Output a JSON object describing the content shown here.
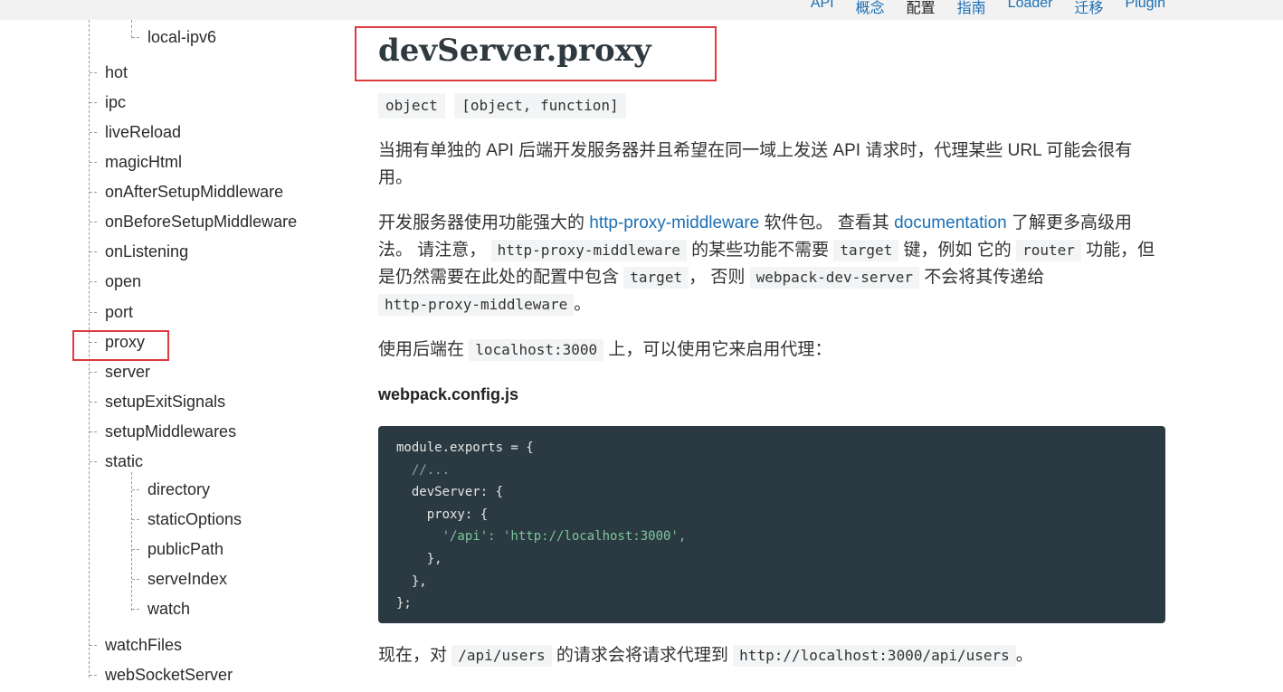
{
  "topnav": {
    "items": [
      "API",
      "概念",
      "配置",
      "指南",
      "Loader",
      "迁移",
      "Plugin"
    ],
    "active_index": 2
  },
  "sidebar": {
    "items": [
      "local-ipv6",
      "hot",
      "ipc",
      "liveReload",
      "magicHtml",
      "onAfterSetupMiddleware",
      "onBeforeSetupMiddleware",
      "onListening",
      "open",
      "port",
      "proxy",
      "server",
      "setupExitSignals",
      "setupMiddlewares",
      "static",
      "directory",
      "staticOptions",
      "publicPath",
      "serveIndex",
      "watch",
      "watchFiles",
      "webSocketServer"
    ],
    "highlighted": "proxy"
  },
  "content": {
    "title": "devServer.proxy",
    "types": [
      "object",
      "[object, function]"
    ],
    "para1": "当拥有单独的 API 后端开发服务器并且希望在同一域上发送 API 请求时，代理某些 URL 可能会很有用。",
    "para2": {
      "t1": "开发服务器使用功能强大的 ",
      "link1": "http-proxy-middleware",
      "t2": " 软件包。 查看其 ",
      "link2": "documentation",
      "t3": " 了解更多高级用法。 请注意， ",
      "code1": "http-proxy-middleware",
      "t4": " 的某些功能不需要 ",
      "code2": "target",
      "t5": " 键，例如 它的 ",
      "code3": "router",
      "t6": " 功能，但是仍然需要在此处的配置中包含 ",
      "code4": "target",
      "t7": "， 否则 ",
      "code5": "webpack-dev-server",
      "t8": " 不会将其传递给 ",
      "code6": "http-proxy-middleware",
      "t9": "。"
    },
    "para3": {
      "t1": "使用后端在 ",
      "code1": "localhost:3000",
      "t2": " 上，可以使用它来启用代理："
    },
    "filename": "webpack.config.js",
    "code_lines": [
      "module.exports = {",
      "  //...",
      "  devServer: {",
      "    proxy: {",
      "      '/api': 'http://localhost:3000',",
      "    },",
      "  },",
      "};"
    ],
    "para4": {
      "t1": "现在，对 ",
      "code1": "/api/users",
      "t2": " 的请求会将请求代理到 ",
      "code2": "http://localhost:3000/api/users",
      "t3": "。"
    }
  },
  "colors": {
    "link": "#1a6fb5",
    "highlight_box": "#e0393e",
    "code_bg": "#2b3a42"
  }
}
